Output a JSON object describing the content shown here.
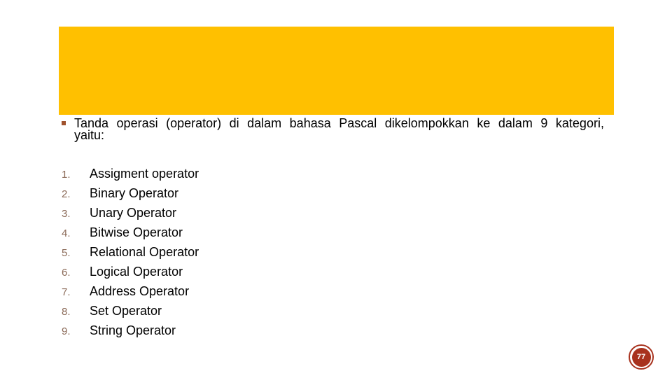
{
  "slide": {
    "title_band_color": "#FFC000",
    "intro": {
      "bullet_icon": "square-bullet-icon",
      "bullet_color": "#A0522D",
      "line1_words": [
        "Tanda",
        "operasi",
        "(operator)",
        "di",
        "dalam",
        "bahasa",
        "Pascal",
        "dikelompokkan",
        "ke",
        "dalam",
        "9",
        "kategori,"
      ],
      "line2": "yaitu:"
    },
    "list": [
      {
        "number": "1.",
        "text": "Assigment operator"
      },
      {
        "number": "2.",
        "text": "Binary Operator"
      },
      {
        "number": "3.",
        "text": "Unary Operator"
      },
      {
        "number": "4.",
        "text": "Bitwise Operator"
      },
      {
        "number": "5.",
        "text": "Relational Operator"
      },
      {
        "number": "6.",
        "text": "Logical Operator"
      },
      {
        "number": "7.",
        "text": "Address Operator"
      },
      {
        "number": "8.",
        "text": "Set Operator"
      },
      {
        "number": "9.",
        "text": "String Operator"
      }
    ],
    "page_number": "77",
    "page_badge_color": "#A8321E"
  }
}
